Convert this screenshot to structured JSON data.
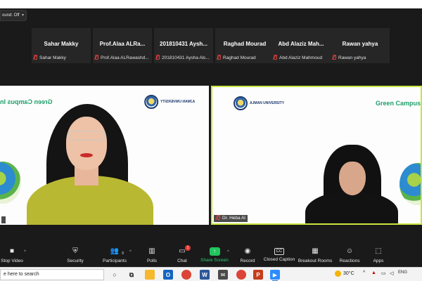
{
  "meeting": {
    "sound_status": "ound: Off"
  },
  "thumbnails": [
    {
      "name": "Sahar Makky",
      "label": "Sahar Makky"
    },
    {
      "name": "Prof.Alaa ALRa...",
      "label": "Prof.Alaa ALRawashd..."
    },
    {
      "name": "201810431 Aysh...",
      "label": "201810431 Aysha Als..."
    },
    {
      "name": "Raghad Mourad",
      "label": "Raghad Mourad"
    },
    {
      "name": "Abd Alaziz Mah...",
      "label": "Abd Alaziz Mahmoud"
    },
    {
      "name": "Rawan yahya",
      "label": "Rawan yahya"
    }
  ],
  "tiles": {
    "left": {
      "banner": "Green Campus In",
      "logo_text": "AJMAN UNIVERSITY"
    },
    "right": {
      "banner": "Green Campus In",
      "logo_text": "AJMAN UNIVERSITY",
      "name": "Dr. Heba Al"
    }
  },
  "toolbar": {
    "stop_video": "Stop Video",
    "security": "Security",
    "participants": "Participants",
    "participants_count": "8",
    "polls": "Polls",
    "chat": "Chat",
    "chat_badge": "1",
    "share_screen": "Share Screen",
    "record": "Record",
    "closed_caption": "Closed Caption",
    "breakout_rooms": "Breakout Rooms",
    "reactions": "Reactions",
    "apps": "Apps"
  },
  "taskbar": {
    "search_placeholder": "e here to search",
    "temperature": "30°C",
    "language": "ENG"
  },
  "colors": {
    "toolbar_bg": "#1a1a1a",
    "share_green": "#22c55e",
    "active_speaker_border": "#c8e640",
    "banner_green": "#1f9e6a"
  }
}
